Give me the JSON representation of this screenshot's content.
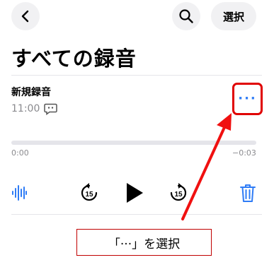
{
  "header": {
    "select_label": "選択"
  },
  "page": {
    "title": "すべての録音"
  },
  "recording": {
    "title": "新規録音",
    "time": "11:00",
    "more_label": "···"
  },
  "player": {
    "elapsed": "0:00",
    "remaining": "−0:03",
    "skip_back_seconds": "15",
    "skip_forward_seconds": "15"
  },
  "annotation": {
    "text": "「···」を選択"
  },
  "icons": [
    "chevron-left-icon",
    "search-icon",
    "transcript-icon",
    "waveform-icon",
    "skip-back-15-icon",
    "play-icon",
    "skip-forward-15-icon",
    "trash-icon"
  ],
  "colors": {
    "accent": "#2f7cf6",
    "highlight": "#e00000",
    "secondary_text": "#8a8a8e"
  }
}
